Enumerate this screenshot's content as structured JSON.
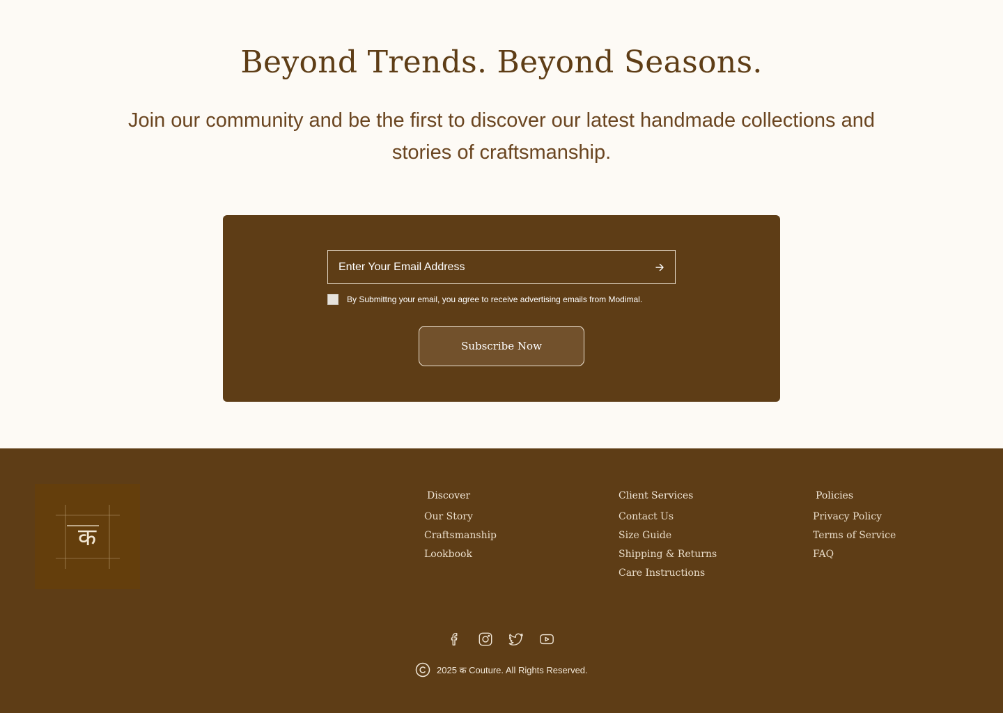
{
  "hero": {
    "title": "Beyond Trends. Beyond Seasons.",
    "subtitle": "Join our community and be the first to discover our latest handmade collections and stories of craftsmanship."
  },
  "newsletter": {
    "email_placeholder": "Enter Your Email Address",
    "consent_text": "By Submittng your email, you agree to receive advertising emails from Modimal.",
    "consent_checked": false,
    "submit_label": "Subscribe Now",
    "submit_icon": "arrow-right-icon"
  },
  "footer": {
    "logo_glyph": "क",
    "columns": {
      "discover": {
        "title": "Discover",
        "links": [
          "Our Story",
          "Craftsmanship",
          "Lookbook"
        ]
      },
      "client": {
        "title": "Client Services",
        "links": [
          "Contact Us",
          "Size Guide",
          "Shipping & Returns",
          "Care Instructions"
        ]
      },
      "policies": {
        "title": "Policies",
        "links": [
          "Privacy Policy",
          "Terms of Service",
          "FAQ"
        ]
      }
    },
    "socials": [
      "facebook-icon",
      "instagram-icon",
      "twitter-icon",
      "youtube-icon"
    ],
    "copyright": "2025 क Couture. All Rights Reserved."
  },
  "colors": {
    "background": "#FDFAF5",
    "brand_brown": "#5E3D16",
    "button_fill": "#72512C",
    "logo_bg": "#643E0C"
  }
}
